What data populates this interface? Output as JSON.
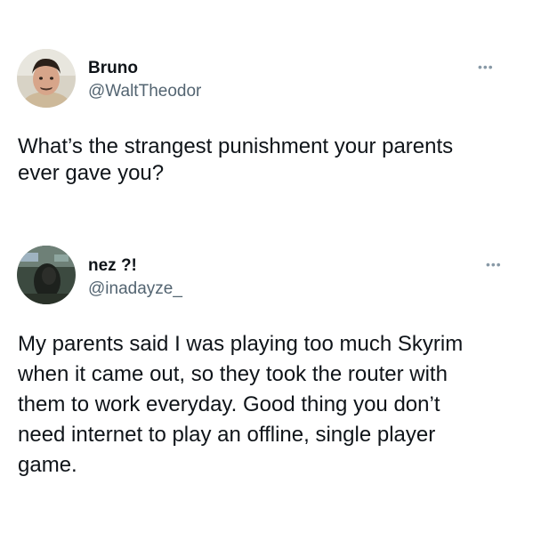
{
  "tweets": [
    {
      "display_name": "Bruno",
      "handle": "@WaltTheodor",
      "more_icon": "ellipsis-icon",
      "text": "What’s the strangest punishment your parents\never gave you?"
    },
    {
      "display_name": "nez ?!",
      "handle": "@inadayze_",
      "more_icon": "ellipsis-icon",
      "text": "My parents said I was playing too much Skyrim\nwhen it came out, so they took the router with\nthem to work everyday. Good thing you don’t\nneed internet to play an offline, single player\ngame."
    }
  ],
  "colors": {
    "text": "#0f1419",
    "handle": "#536471",
    "more": "#8899a6",
    "background": "#ffffff"
  }
}
